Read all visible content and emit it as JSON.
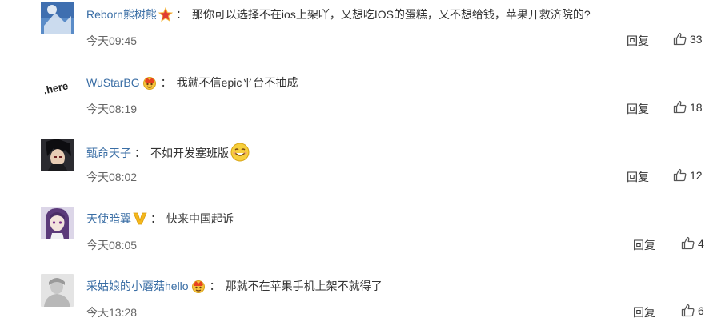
{
  "comments": [
    {
      "username": "Reborn熊树熊",
      "badge": "star-badge-icon",
      "colon": "：",
      "text": "那你可以选择不在ios上架吖，又想吃IOS的蛋糕，又不想给钱，苹果开救济院的?",
      "time": "今天09:45",
      "reply": "回复",
      "likes": "33",
      "avatar": "blue-cloud-avatar"
    },
    {
      "username": "WuStarBG",
      "badge": "crown-badge-icon",
      "colon": "：",
      "text": "我就不信epic平台不抽成",
      "time": "今天08:19",
      "reply": "回复",
      "likes": "18",
      "avatar": "here-logo-avatar",
      "avatar_text": ".here"
    },
    {
      "username": "甄命天子",
      "colon": "：",
      "text": "不如开发塞班版",
      "emoji": "smile-emoji-icon",
      "time": "今天08:02",
      "reply": "回复",
      "likes": "12",
      "avatar": "anime-dark-avatar"
    },
    {
      "username": "天使暗翼",
      "badge": "v-badge-icon",
      "colon": "：",
      "text": "快来中国起诉",
      "time": "今天08:05",
      "reply": "回复",
      "likes": "4",
      "avatar": "anime-purple-avatar"
    },
    {
      "username": "采姑娘的小蘑菇hello",
      "badge": "crown-badge-icon",
      "colon": "：",
      "text": "那就不在苹果手机上架不就得了",
      "time": "今天13:28",
      "reply": "回复",
      "likes": "6",
      "avatar": "gray-photo-avatar"
    }
  ],
  "colors": {
    "username": "#3a6ea5",
    "text": "#333333",
    "time": "#666666",
    "divider": "#eeeeee"
  }
}
